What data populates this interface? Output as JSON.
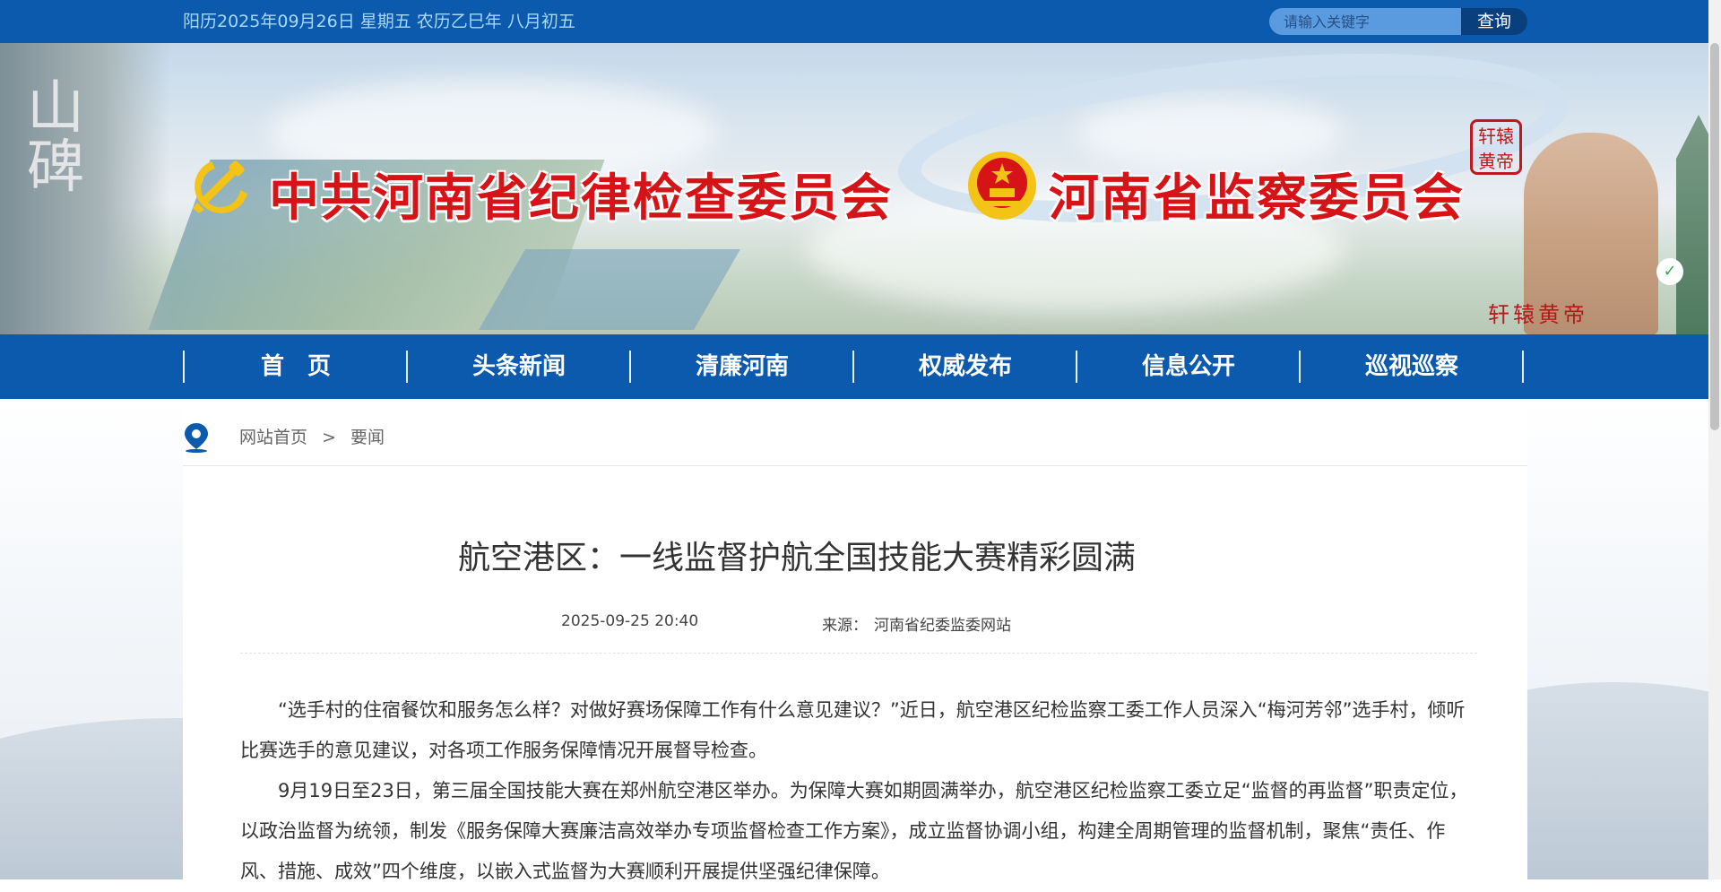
{
  "topbar": {
    "date_text": "阳历2025年09月26日 星期五 农历乙巳年 八月初五",
    "search_placeholder": "请输入关键字",
    "search_button": "查询"
  },
  "banner": {
    "rock_text": "山碑",
    "title_party": "中共河南省纪律检查委员会",
    "title_state": "河南省监察委员会",
    "seal_text": "轩辕黄帝",
    "statue_label": "轩辕黄帝",
    "wechat_icon": "wechat-icon"
  },
  "nav": {
    "items": [
      {
        "label": "首　页"
      },
      {
        "label": "头条新闻"
      },
      {
        "label": "清廉河南"
      },
      {
        "label": "权威发布"
      },
      {
        "label": "信息公开"
      },
      {
        "label": "巡视巡察"
      }
    ]
  },
  "breadcrumb": {
    "icon": "location-pin-icon",
    "home": "网站首页",
    "separator": ">",
    "current": "要闻"
  },
  "article": {
    "title": "航空港区：一线监督护航全国技能大赛精彩圆满",
    "date": "2025-09-25 20:40",
    "source_label": "来源：",
    "source": "河南省纪委监委网站",
    "paragraphs": [
      "“选手村的住宿餐饮和服务怎么样？对做好赛场保障工作有什么意见建议？”近日，航空港区纪检监察工委工作人员深入“梅河芳邻”选手村，倾听比赛选手的意见建议，对各项工作服务保障情况开展督导检查。",
      "9月19日至23日，第三届全国技能大赛在郑州航空港区举办。为保障大赛如期圆满举办，航空港区纪检监察工委立足“监督的再监督”职责定位，以政治监督为统领，制发《服务保障大赛廉洁高效举办专项监督检查工作方案》，成立监督协调小组，构建全周期管理的监督机制，聚焦“责任、作风、措施、成效”四个维度，以嵌入式监督为大赛顺利开展提供坚强纪律保障。"
    ]
  },
  "colors": {
    "brand_blue": "#0b5aae",
    "title_red": "#d61418"
  }
}
